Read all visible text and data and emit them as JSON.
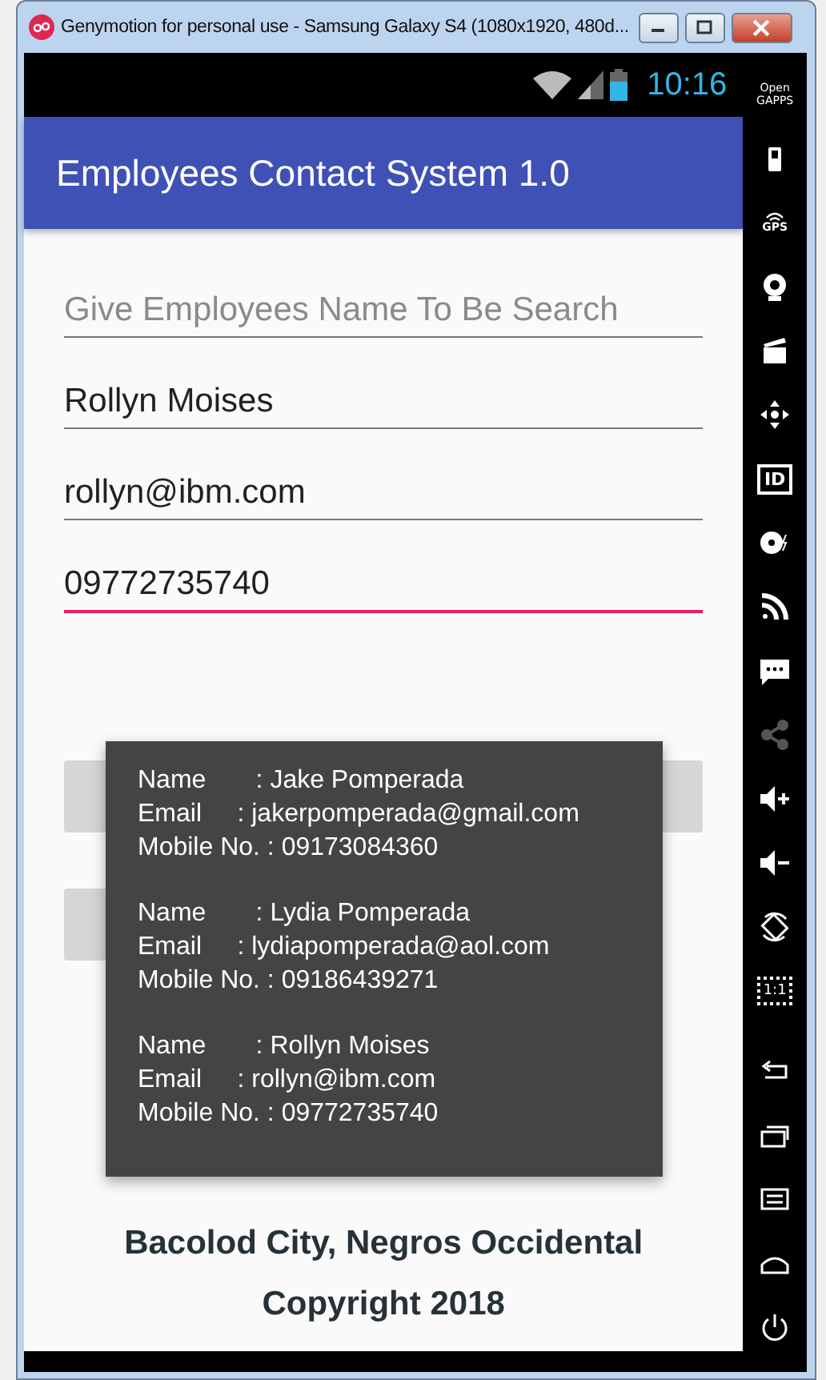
{
  "window": {
    "title": "Genymotion for personal use - Samsung Galaxy S4 (1080x1920, 480d..."
  },
  "status_bar": {
    "time": "10:16"
  },
  "app_bar": {
    "title": "Employees Contact System 1.0"
  },
  "fields": [
    {
      "placeholder": "Give Employees Name To Be Search",
      "focused": false
    },
    {
      "value": "Rollyn Moises",
      "focused": false
    },
    {
      "value": "rollyn@ibm.com",
      "focused": false
    },
    {
      "value": "09772735740",
      "focused": true
    }
  ],
  "credits": [
    "Bacolod City, Negros Occidental",
    "Copyright 2018"
  ],
  "toast": {
    "records": [
      [
        "Name       : Jake Pomperada",
        "Email     : jakerpomperada@gmail.com",
        "Mobile No. : 09173084360"
      ],
      [
        "Name       : Lydia Pomperada",
        "Email     : lydiapomperada@aol.com",
        "Mobile No. : 09186439271"
      ],
      [
        "Name       : Rollyn Moises",
        "Email     : rollyn@ibm.com",
        "Mobile No. : 09772735740"
      ]
    ]
  },
  "sidebar": {
    "top": [
      {
        "kind": "gapps",
        "label": "Open GAPPS"
      },
      {
        "kind": "battery"
      },
      {
        "kind": "gps",
        "label": "GPS"
      },
      {
        "kind": "webcam"
      },
      {
        "kind": "clapper"
      },
      {
        "kind": "dpad"
      },
      {
        "kind": "id",
        "label": "ID"
      },
      {
        "kind": "disk"
      },
      {
        "kind": "rss"
      },
      {
        "kind": "sms"
      },
      {
        "kind": "share"
      },
      {
        "kind": "volup"
      },
      {
        "kind": "voldown"
      },
      {
        "kind": "rotate"
      },
      {
        "kind": "scale",
        "label": "1:1"
      }
    ],
    "bottom": [
      {
        "kind": "back"
      },
      {
        "kind": "recent"
      },
      {
        "kind": "menu"
      },
      {
        "kind": "home"
      },
      {
        "kind": "power"
      }
    ]
  }
}
